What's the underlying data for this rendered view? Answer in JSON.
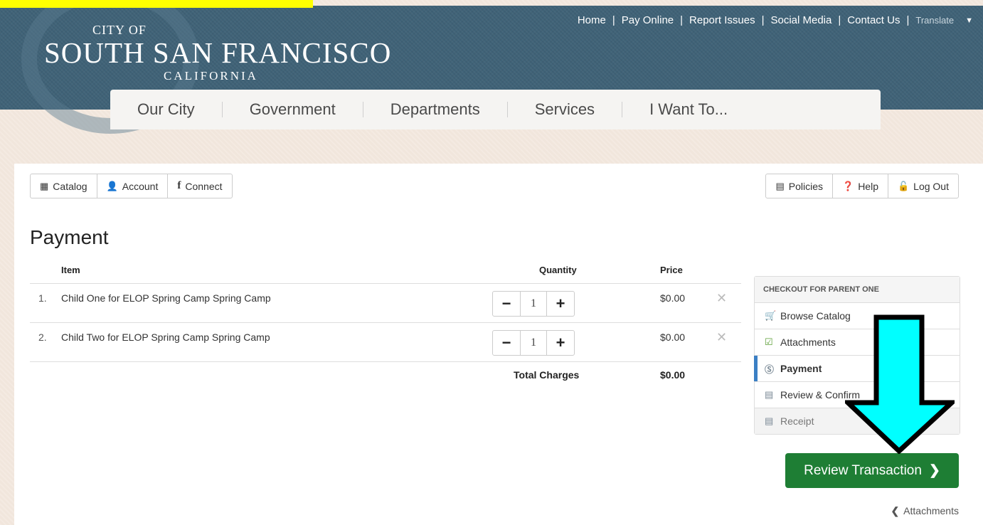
{
  "header": {
    "city_of": "CITY OF",
    "city_name": "SOUTH SAN FRANCISCO",
    "state": "CALIFORNIA",
    "top_links": [
      "Home",
      "Pay Online",
      "Report Issues",
      "Social Media",
      "Contact Us"
    ],
    "translate": "Translate"
  },
  "main_nav": [
    "Our City",
    "Government",
    "Departments",
    "Services",
    "I Want To..."
  ],
  "toolbar_left": [
    {
      "label": "Catalog",
      "icon": "grid-icon"
    },
    {
      "label": "Account",
      "icon": "user-icon"
    },
    {
      "label": "Connect",
      "icon": "facebook-icon"
    }
  ],
  "toolbar_right": [
    {
      "label": "Policies",
      "icon": "document-icon"
    },
    {
      "label": "Help",
      "icon": "question-icon"
    },
    {
      "label": "Log Out",
      "icon": "unlock-icon"
    }
  ],
  "page_title": "Payment",
  "cart": {
    "columns": {
      "item": "Item",
      "quantity": "Quantity",
      "price": "Price"
    },
    "rows": [
      {
        "num": "1.",
        "name": "Child One for ELOP Spring Camp Spring Camp",
        "quantity": "1",
        "price": "$0.00"
      },
      {
        "num": "2.",
        "name": "Child Two for ELOP Spring Camp Spring Camp",
        "quantity": "1",
        "price": "$0.00"
      }
    ],
    "total_label": "Total Charges",
    "total_value": "$0.00"
  },
  "checkout": {
    "heading": "CHECKOUT FOR PARENT ONE",
    "steps": [
      {
        "label": "Browse Catalog",
        "icon": "cart-icon"
      },
      {
        "label": "Attachments",
        "icon": "clipboard-check-icon"
      },
      {
        "label": "Payment",
        "icon": "dollar-circle-icon",
        "active": true
      },
      {
        "label": "Review & Confirm",
        "icon": "document-icon"
      },
      {
        "label": "Receipt",
        "icon": "document-icon"
      }
    ]
  },
  "review_button": "Review Transaction",
  "back_link": "Attachments",
  "colors": {
    "header_bg": "#3f6277",
    "primary_button": "#1e7e34",
    "active_step": "#3b7fc4",
    "annotation_arrow": "#00ffff"
  }
}
